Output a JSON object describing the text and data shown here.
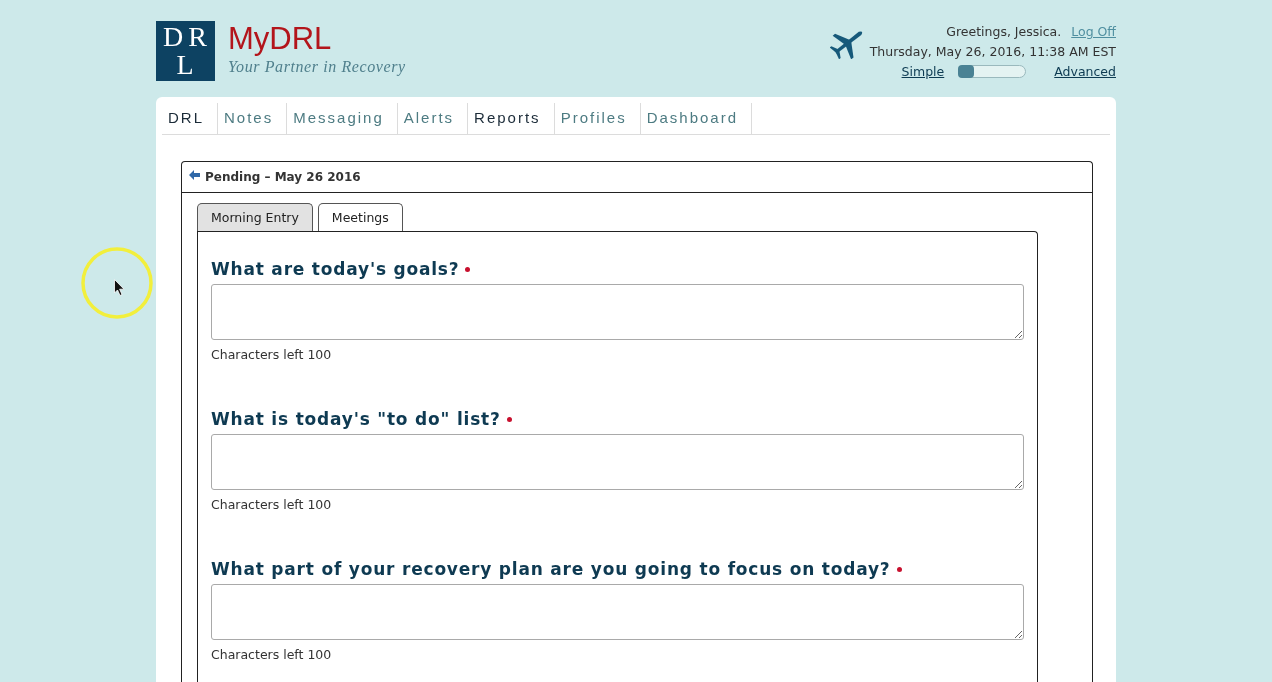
{
  "logo": {
    "lines": [
      "DR",
      "L"
    ]
  },
  "brand": {
    "name": "MyDRL",
    "tagline": "Your Partner in Recovery"
  },
  "user_panel": {
    "greeting": "Greetings, Jessica.",
    "logout_link": "Log Off",
    "datetime": "Thursday, May 26, 2016, 11:38 AM EST",
    "mode_slider": {
      "left_label": "Simple",
      "right_label": "Advanced",
      "level": 0
    }
  },
  "nav_tabs": [
    {
      "label": "DRL",
      "selected": true
    },
    {
      "label": "Notes",
      "selected": false
    },
    {
      "label": "Messaging",
      "selected": false
    },
    {
      "label": "Alerts",
      "selected": false
    },
    {
      "label": "Reports",
      "selected": true
    },
    {
      "label": "Profiles",
      "selected": false
    },
    {
      "label": "Dashboard",
      "selected": false
    }
  ],
  "entry_panel": {
    "title": "Pending – May 26 2016",
    "tabs": [
      {
        "label": "Morning Entry",
        "selected": false
      },
      {
        "label": "Meetings",
        "selected": true
      }
    ],
    "questions": [
      {
        "label": "What are today's goals?",
        "required": true,
        "counter": "Characters left 100"
      },
      {
        "label": "What is today's \"to do\" list?",
        "required": true,
        "counter": "Characters left 100"
      },
      {
        "label": "What part of your recovery plan are you going to focus on today?",
        "required": true,
        "counter": "Characters left 100"
      }
    ]
  }
}
